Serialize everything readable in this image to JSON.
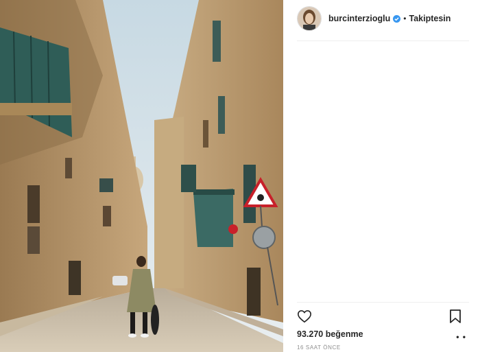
{
  "post": {
    "username": "burcinterzioglu",
    "follow_status": "Takiptesin",
    "separator": "•",
    "likes": "93.270 beğenme",
    "time_ago": "16 SAAT ÖNCE",
    "more_glyph": "• •"
  },
  "icons": {
    "verified": "verified-badge-icon",
    "like": "heart-icon",
    "save": "bookmark-icon",
    "more": "more-options-icon"
  },
  "colors": {
    "verified_blue": "#3897f0",
    "divider": "#efefef",
    "muted": "#8e8e8e"
  }
}
